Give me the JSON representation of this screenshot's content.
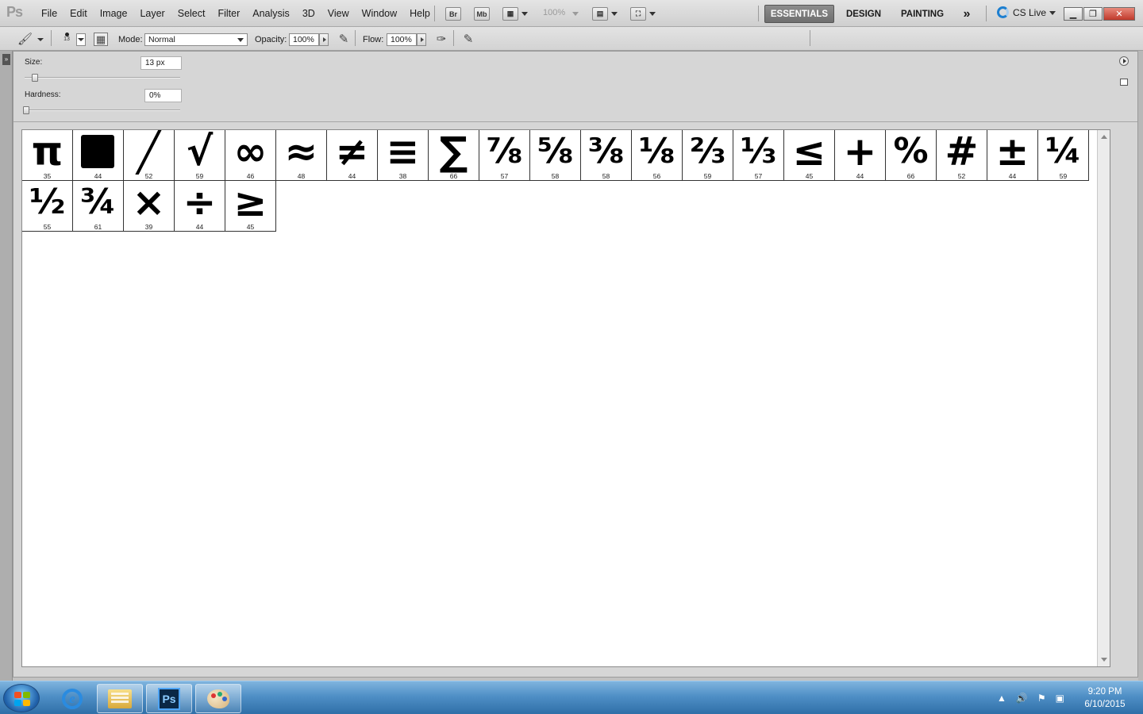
{
  "app": {
    "logo": "Ps"
  },
  "menu": [
    "File",
    "Edit",
    "Image",
    "Layer",
    "Select",
    "Filter",
    "Analysis",
    "3D",
    "View",
    "Window",
    "Help"
  ],
  "appbar": {
    "bridge": "Br",
    "minibridge": "Mb",
    "zoom": "100%",
    "workspaces": [
      "ESSENTIALS",
      "DESIGN",
      "PAINTING"
    ],
    "more": "»",
    "cslive": "CS Live"
  },
  "options": {
    "brush_size_small": "13",
    "mode_label": "Mode:",
    "mode_value": "Normal",
    "opacity_label": "Opacity:",
    "opacity_value": "100%",
    "flow_label": "Flow:",
    "flow_value": "100%"
  },
  "picker": {
    "size_label": "Size:",
    "size_value": "13 px",
    "hardness_label": "Hardness:",
    "hardness_value": "0%"
  },
  "presets": [
    {
      "glyph": "π",
      "size": "35"
    },
    {
      "glyph": "■",
      "size": "44"
    },
    {
      "glyph": "╱",
      "size": "52"
    },
    {
      "glyph": "√",
      "size": "59"
    },
    {
      "glyph": "∞",
      "size": "46"
    },
    {
      "glyph": "≈",
      "size": "48"
    },
    {
      "glyph": "≠",
      "size": "44"
    },
    {
      "glyph": "≡",
      "size": "38"
    },
    {
      "glyph": "∑",
      "size": "66"
    },
    {
      "glyph": "⅞",
      "size": "57"
    },
    {
      "glyph": "⅝",
      "size": "58"
    },
    {
      "glyph": "⅜",
      "size": "58"
    },
    {
      "glyph": "⅛",
      "size": "56"
    },
    {
      "glyph": "⅔",
      "size": "59"
    },
    {
      "glyph": "⅓",
      "size": "57"
    },
    {
      "glyph": "≤",
      "size": "45"
    },
    {
      "glyph": "+",
      "size": "44"
    },
    {
      "glyph": "%",
      "size": "66"
    },
    {
      "glyph": "#",
      "size": "52"
    },
    {
      "glyph": "±",
      "size": "44"
    },
    {
      "glyph": "¼",
      "size": "59"
    },
    {
      "glyph": "½",
      "size": "55"
    },
    {
      "glyph": "¾",
      "size": "61"
    },
    {
      "glyph": "×",
      "size": "39"
    },
    {
      "glyph": "÷",
      "size": "44"
    },
    {
      "glyph": "≥",
      "size": "45"
    }
  ],
  "taskbar": {
    "ps_label": "Ps",
    "ie_label": "e",
    "time": "9:20 PM",
    "date": "6/10/2015"
  }
}
